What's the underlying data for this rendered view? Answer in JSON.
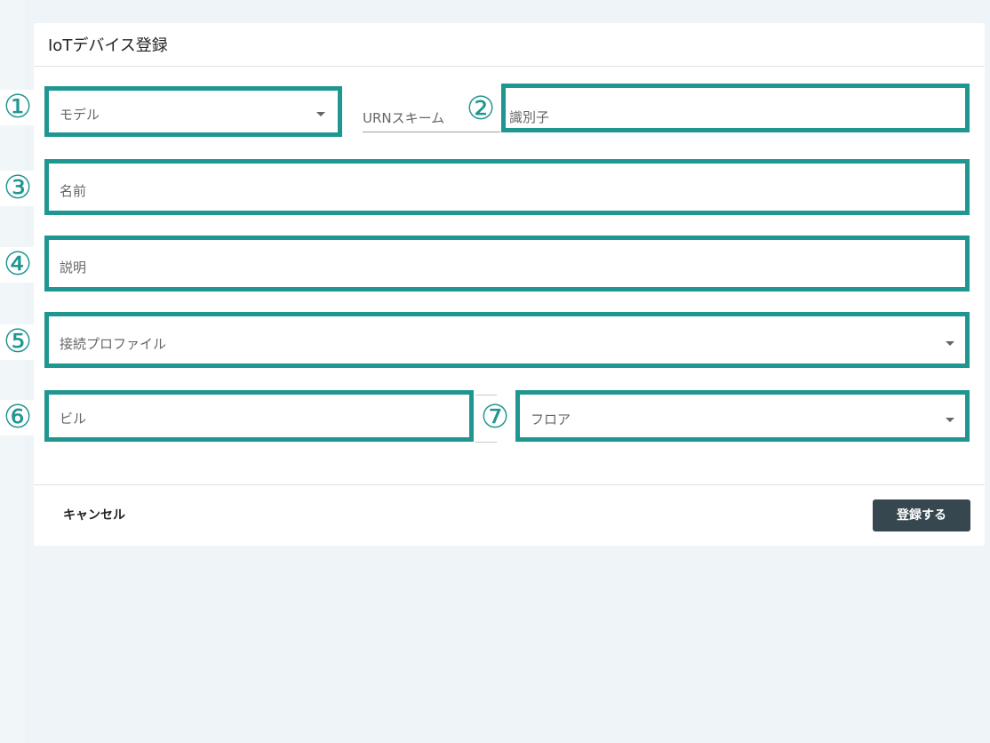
{
  "dialog": {
    "title": "IoTデバイス登録"
  },
  "markers": [
    "①",
    "②",
    "③",
    "④",
    "⑤",
    "⑥",
    "⑦"
  ],
  "fields": {
    "model": {
      "label": "モデル",
      "type": "select"
    },
    "urn_scheme": {
      "label": "URNスキーム"
    },
    "identifier": {
      "label": "識別子"
    },
    "name": {
      "label": "名前"
    },
    "description": {
      "label": "説明"
    },
    "connection_profile": {
      "label": "接続プロファイル",
      "type": "select"
    },
    "building": {
      "label": "ビル"
    },
    "floor": {
      "label": "フロア",
      "type": "select"
    }
  },
  "actions": {
    "cancel_label": "キャンセル",
    "submit_label": "登録する"
  },
  "colors": {
    "highlight": "#1f9690",
    "submit_button": "#37474f",
    "background": "#eef4f8"
  }
}
